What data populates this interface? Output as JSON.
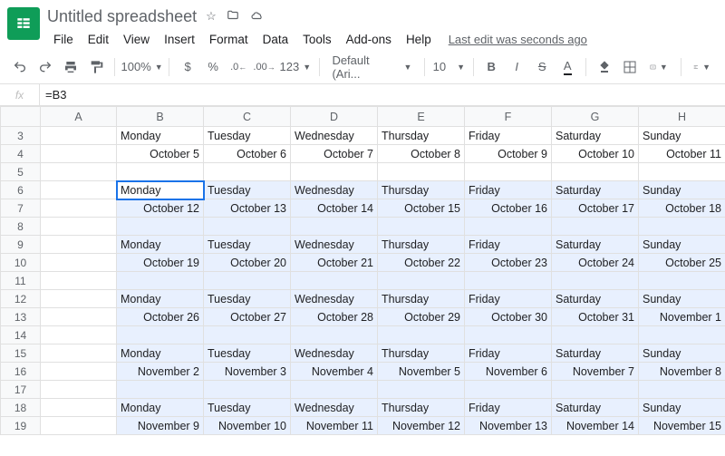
{
  "doc": {
    "title": "Untitled spreadsheet",
    "last_edit": "Last edit was seconds ago"
  },
  "menu": {
    "file": "File",
    "edit": "Edit",
    "view": "View",
    "insert": "Insert",
    "format": "Format",
    "data": "Data",
    "tools": "Tools",
    "addons": "Add-ons",
    "help": "Help"
  },
  "toolbar": {
    "zoom": "100%",
    "currency": "$",
    "percent": "%",
    "dec_dec": ".0",
    "inc_dec": ".00",
    "more_fmt": "123",
    "font": "Default (Ari...",
    "font_size": "10",
    "bold": "B",
    "italic": "I",
    "strike": "S",
    "text_color": "A"
  },
  "fx": {
    "label": "fx",
    "value": "=B3"
  },
  "columns": [
    "",
    "A",
    "B",
    "C",
    "D",
    "E",
    "F",
    "G",
    "H"
  ],
  "days": {
    "mon": "Monday",
    "tue": "Tuesday",
    "wed": "Wednesday",
    "thu": "Thursday",
    "fri": "Friday",
    "sat": "Saturday",
    "sun": "Sunday"
  },
  "rows": {
    "3": "3",
    "4": "4",
    "5": "5",
    "6": "6",
    "7": "7",
    "8": "8",
    "9": "9",
    "10": "10",
    "11": "11",
    "12": "12",
    "13": "13",
    "14": "14",
    "15": "15",
    "16": "16",
    "17": "17",
    "18": "18",
    "19": "19"
  },
  "dates": {
    "w1": [
      "October 5",
      "October 6",
      "October 7",
      "October 8",
      "October 9",
      "October 10",
      "October 11"
    ],
    "w2": [
      "October 12",
      "October 13",
      "October 14",
      "October 15",
      "October 16",
      "October 17",
      "October 18"
    ],
    "w3": [
      "October 19",
      "October 20",
      "October 21",
      "October 22",
      "October 23",
      "October 24",
      "October 25"
    ],
    "w4": [
      "October 26",
      "October 27",
      "October 28",
      "October 29",
      "October 30",
      "October 31",
      "November 1"
    ],
    "w5": [
      "November 2",
      "November 3",
      "November 4",
      "November 5",
      "November 6",
      "November 7",
      "November 8"
    ],
    "w6": [
      "November 9",
      "November 10",
      "November 11",
      "November 12",
      "November 13",
      "November 14",
      "November 15"
    ]
  },
  "chart_data": {
    "type": "table",
    "title": "Untitled spreadsheet",
    "active_cell": "B6",
    "formula": "=B3",
    "selection_range": "B6:H19",
    "columns": [
      "A",
      "B",
      "C",
      "D",
      "E",
      "F",
      "G",
      "H"
    ],
    "visible_rows": [
      3,
      4,
      5,
      6,
      7,
      8,
      9,
      10,
      11,
      12,
      13,
      14,
      15,
      16,
      17,
      18,
      19
    ],
    "cells": {
      "B3": "Monday",
      "C3": "Tuesday",
      "D3": "Wednesday",
      "E3": "Thursday",
      "F3": "Friday",
      "G3": "Saturday",
      "H3": "Sunday",
      "B4": "October 5",
      "C4": "October 6",
      "D4": "October 7",
      "E4": "October 8",
      "F4": "October 9",
      "G4": "October 10",
      "H4": "October 11",
      "B6": "Monday",
      "C6": "Tuesday",
      "D6": "Wednesday",
      "E6": "Thursday",
      "F6": "Friday",
      "G6": "Saturday",
      "H6": "Sunday",
      "B7": "October 12",
      "C7": "October 13",
      "D7": "October 14",
      "E7": "October 15",
      "F7": "October 16",
      "G7": "October 17",
      "H7": "October 18",
      "B9": "Monday",
      "C9": "Tuesday",
      "D9": "Wednesday",
      "E9": "Thursday",
      "F9": "Friday",
      "G9": "Saturday",
      "H9": "Sunday",
      "B10": "October 19",
      "C10": "October 20",
      "D10": "October 21",
      "E10": "October 22",
      "F10": "October 23",
      "G10": "October 24",
      "H10": "October 25",
      "B12": "Monday",
      "C12": "Tuesday",
      "D12": "Wednesday",
      "E12": "Thursday",
      "F12": "Friday",
      "G12": "Saturday",
      "H12": "Sunday",
      "B13": "October 26",
      "C13": "October 27",
      "D13": "October 28",
      "E13": "October 29",
      "F13": "October 30",
      "G13": "October 31",
      "H13": "November 1",
      "B15": "Monday",
      "C15": "Tuesday",
      "D15": "Wednesday",
      "E15": "Thursday",
      "F15": "Friday",
      "G15": "Saturday",
      "H15": "Sunday",
      "B16": "November 2",
      "C16": "November 3",
      "D16": "November 4",
      "E16": "November 5",
      "F16": "November 6",
      "G16": "November 7",
      "H16": "November 8",
      "B18": "Monday",
      "C18": "Tuesday",
      "D18": "Wednesday",
      "E18": "Thursday",
      "F18": "Friday",
      "G18": "Saturday",
      "H18": "Sunday",
      "B19": "November 9",
      "C19": "November 10",
      "D19": "November 11",
      "E19": "November 12",
      "F19": "November 13",
      "G19": "November 14",
      "H19": "November 15"
    }
  }
}
